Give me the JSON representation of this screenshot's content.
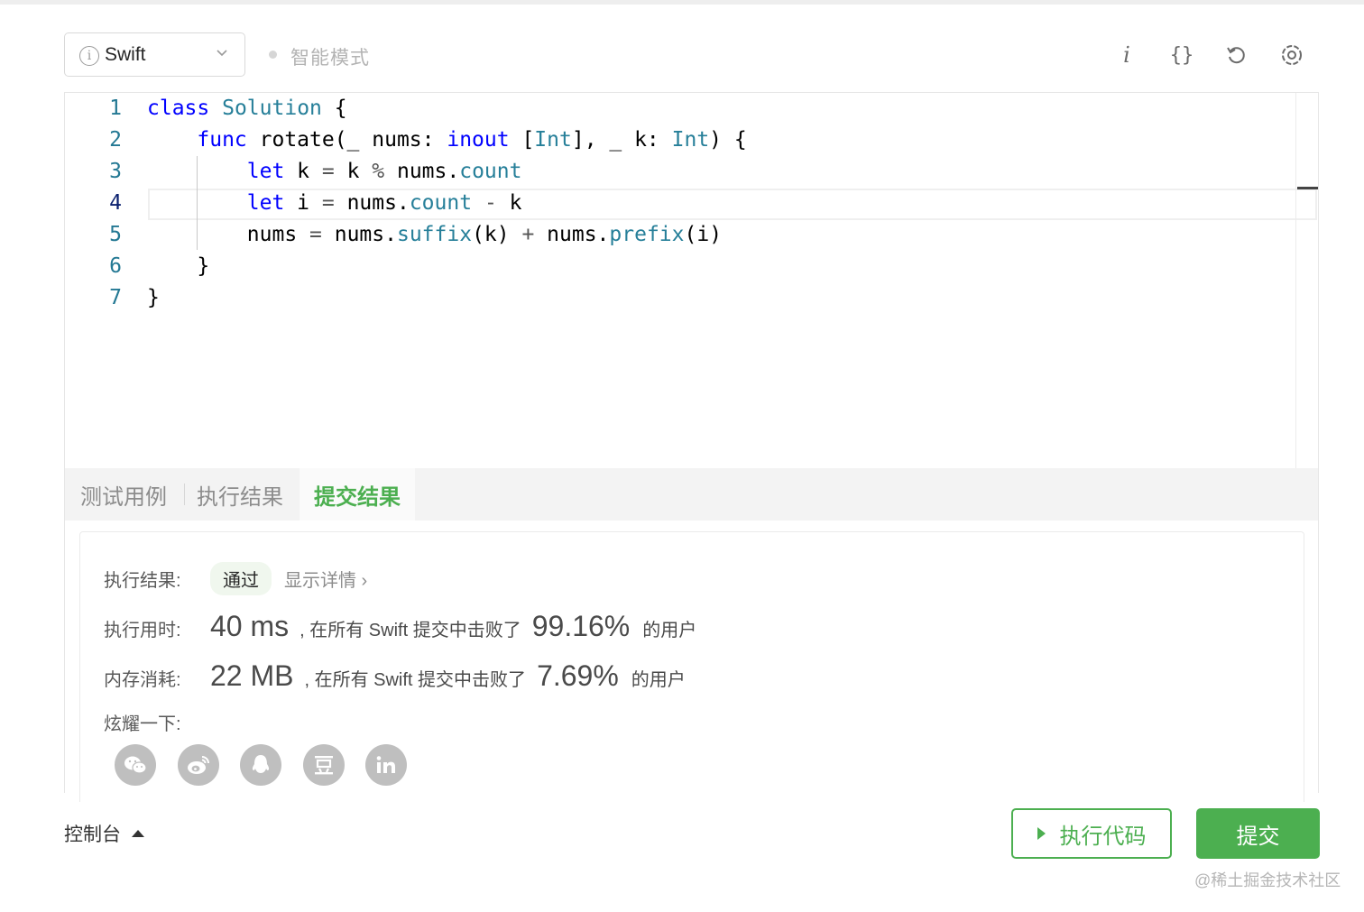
{
  "toolbar": {
    "language": "Swift",
    "mode_label": "智能模式",
    "icons": [
      "info-icon",
      "braces-icon",
      "reset-icon",
      "settings-icon"
    ]
  },
  "editor": {
    "line_numbers": [
      "1",
      "2",
      "3",
      "4",
      "5",
      "6",
      "7"
    ]
  },
  "tabs": {
    "test_cases": "测试用例",
    "run_result": "执行结果",
    "submit_result": "提交结果"
  },
  "result": {
    "status_label": "执行结果:",
    "status_value": "通过",
    "details_link": "显示详情 ›",
    "time_label": "执行用时:",
    "time_value": "40 ms",
    "time_mid": ", 在所有 Swift 提交中击败了",
    "time_pct": "99.16%",
    "time_tail": "的用户",
    "mem_label": "内存消耗:",
    "mem_value": "22 MB",
    "mem_mid": ", 在所有 Swift 提交中击败了",
    "mem_pct": "7.69%",
    "mem_tail": "的用户",
    "share_label": "炫耀一下:",
    "share_icons": [
      "wechat-icon",
      "weibo-icon",
      "qq-icon",
      "douban-icon",
      "linkedin-icon"
    ]
  },
  "footer": {
    "console": "控制台",
    "run_button": "执行代码",
    "submit_button": "提交"
  },
  "watermark": "@稀土掘金技术社区",
  "colors": {
    "accent_green": "#4caf50",
    "keyword_blue": "#0000ff",
    "type_teal": "#267f99",
    "line_number": "#237893"
  }
}
